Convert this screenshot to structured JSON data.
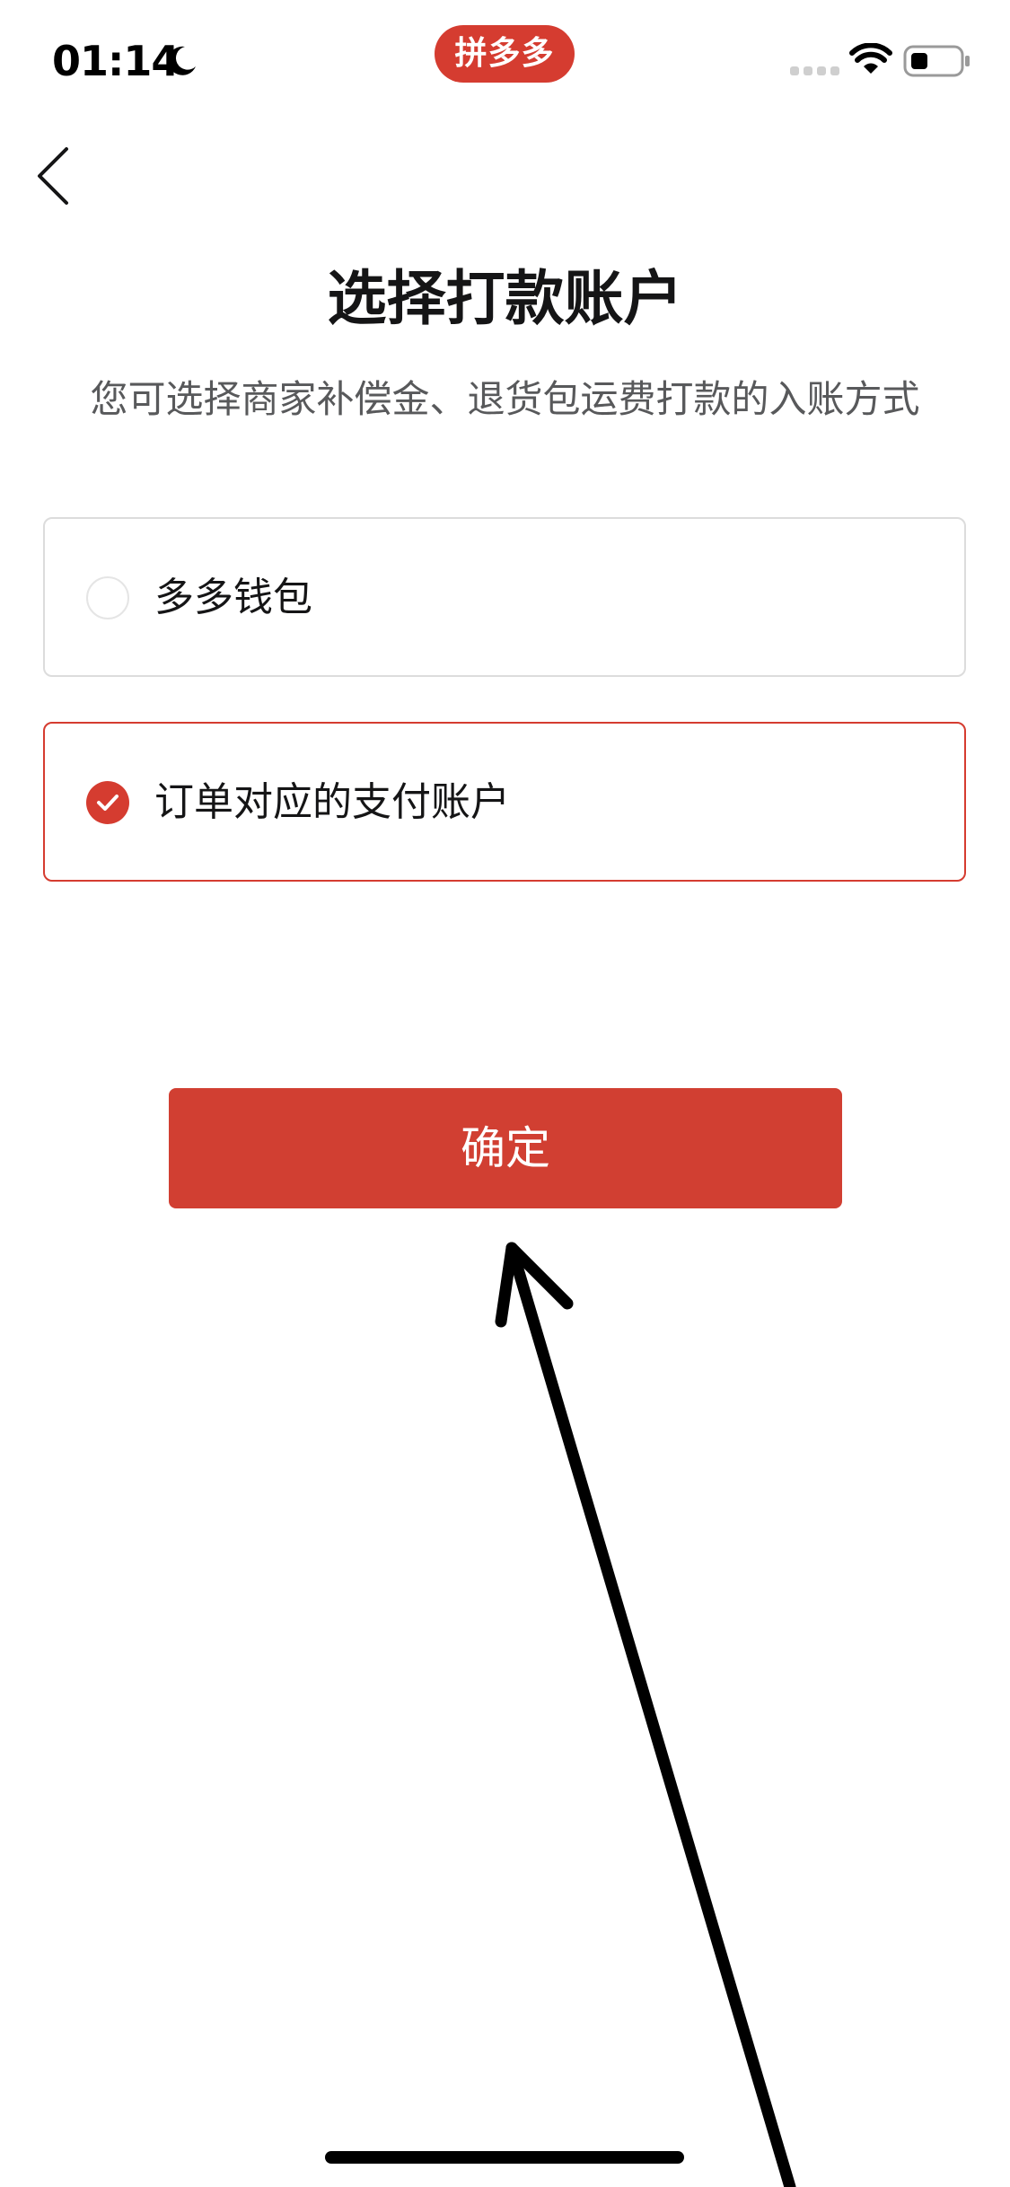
{
  "status_bar": {
    "time": "01:14",
    "moon_icon": "moon-icon",
    "signal_icon": "cellular-signal-icon",
    "wifi_icon": "wifi-icon",
    "battery_icon": "battery-icon"
  },
  "app_badge": {
    "label": "拼多多",
    "color": "#d53c30"
  },
  "nav": {
    "back_icon": "chevron-left-icon"
  },
  "page": {
    "title": "选择打款账户",
    "subtitle": "您可选择商家补偿金、退货包运费打款的入账方式"
  },
  "options": [
    {
      "label": "多多钱包",
      "selected": false
    },
    {
      "label": "订单对应的支付账户",
      "selected": true
    }
  ],
  "confirm": {
    "label": "确定"
  },
  "colors": {
    "accent": "#d53c30",
    "border": "#dcdcdc",
    "subtitle": "#58595b"
  }
}
